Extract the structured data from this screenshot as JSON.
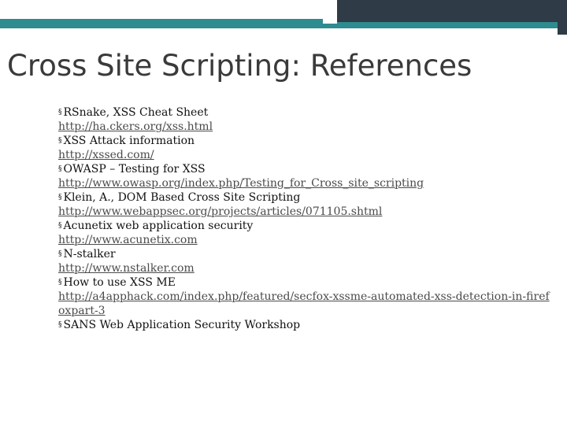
{
  "slide": {
    "title": "Cross Site Scripting: References",
    "bullet_glyph": "§",
    "references": [
      {
        "label": "RSnake, XSS Cheat Sheet",
        "url": "http://ha.ckers.org/xss.html"
      },
      {
        "label": "XSS Attack information",
        "url": "http://xssed.com/"
      },
      {
        "label": "OWASP – Testing for XSS",
        "url": "http://www.owasp.org/index.php/Testing_for_Cross_site_scripting"
      },
      {
        "label": "Klein, A., DOM Based Cross Site Scripting",
        "url": "http://www.webappsec.org/projects/articles/071105.shtml"
      },
      {
        "label": "Acunetix web application security",
        "url": "http://www.acunetix.com"
      },
      {
        "label": "N-stalker",
        "url": "http://www.nstalker.com"
      },
      {
        "label": "How to use XSS ME",
        "url": "http://a4apphack.com/index.php/featured/secfox-xssme-automated-xss-detection-in-firefoxpart-3"
      },
      {
        "label": "SANS Web Application Security Workshop",
        "url": ""
      }
    ]
  },
  "colors": {
    "teal_band": "#2e8b8f",
    "dark_band": "#2f3b47",
    "title_text": "#3a3a3a",
    "body_text": "#111111",
    "link_text": "#4a4a4a"
  }
}
